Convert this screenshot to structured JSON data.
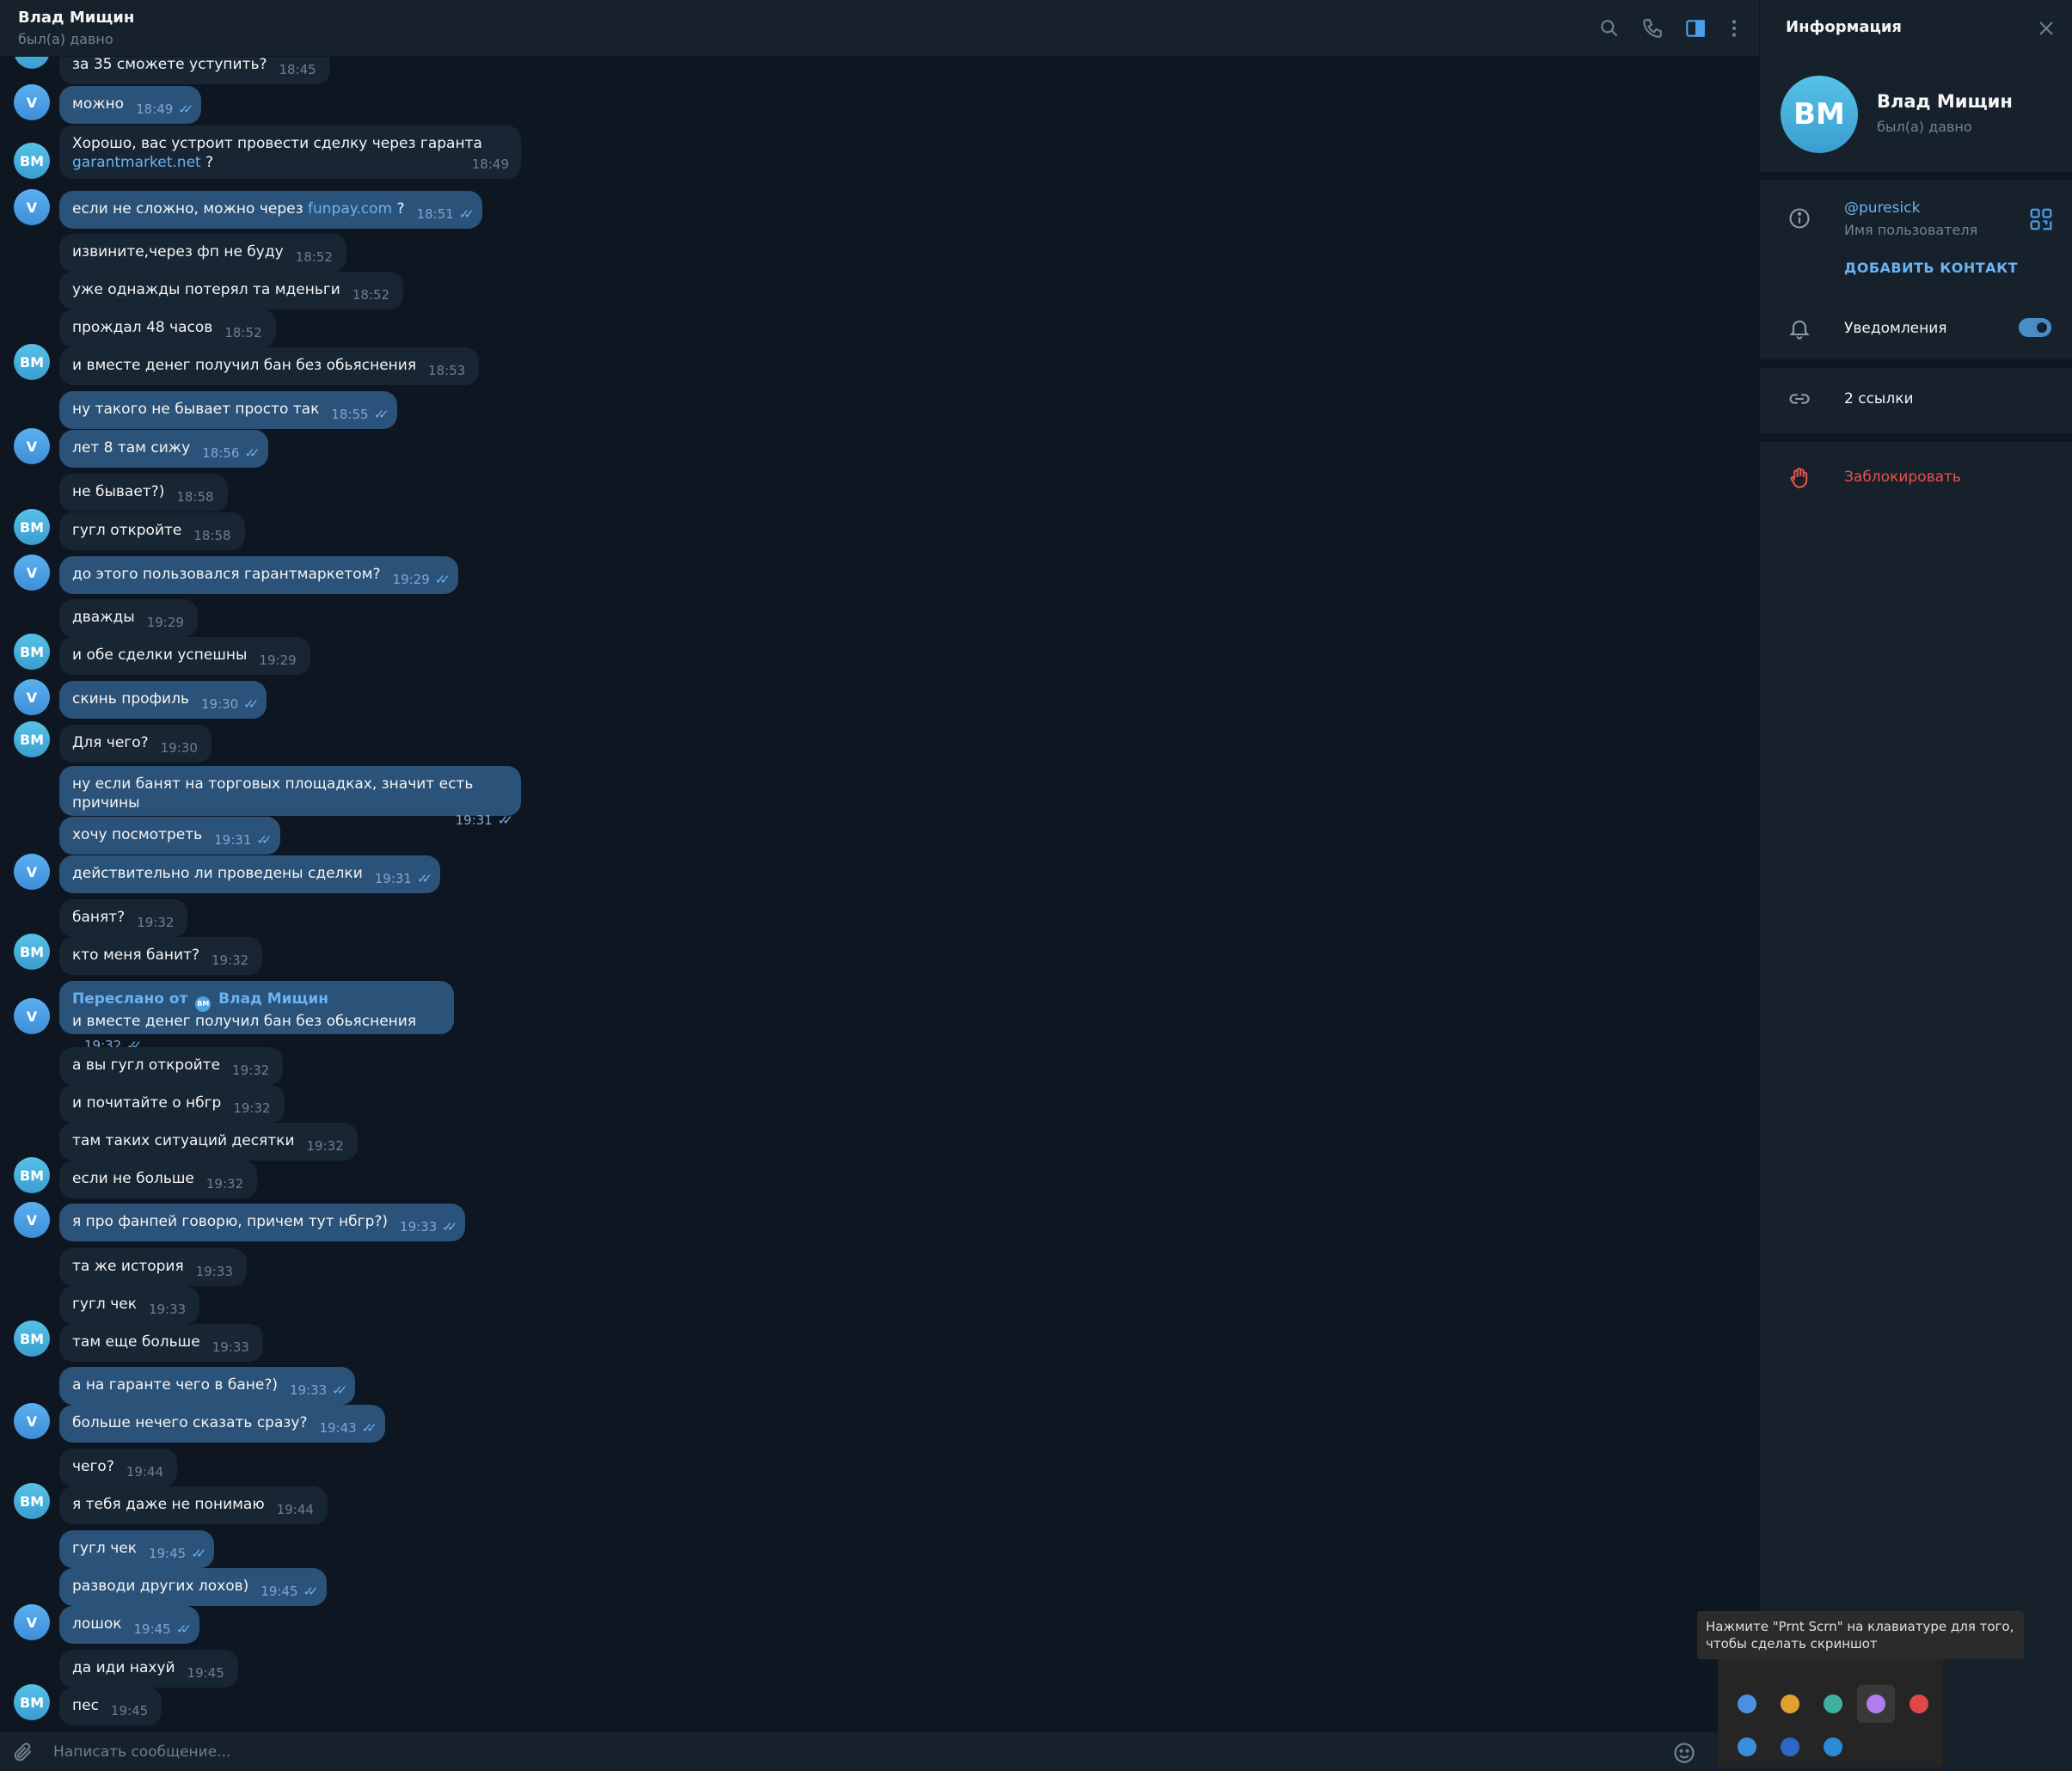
{
  "header": {
    "name": "Влад Мищин",
    "status": "был(а) давно"
  },
  "messages": [
    {
      "dir": "in",
      "text": "за 35 сможете уступить?",
      "time": "18:45",
      "read": false
    },
    {
      "dir": "out",
      "text": "можно",
      "time": "18:49",
      "read": true
    },
    {
      "dir": "in",
      "line1": "Хорошо, вас устроит провести сделку через гаранта",
      "link": "garantmarket.net",
      "after": " ?",
      "time": "18:49",
      "read": false
    },
    {
      "dir": "out",
      "pre": "если не сложно, можно через ",
      "link": "funpay.com",
      "after": " ?",
      "time": "18:51",
      "read": true
    },
    {
      "dir": "in",
      "text": "извините,через фп не буду",
      "time": "18:52",
      "read": false
    },
    {
      "dir": "in",
      "text": "уже однажды потерял та мденьги",
      "time": "18:52",
      "read": false
    },
    {
      "dir": "in",
      "text": "прождал 48 часов",
      "time": "18:52",
      "read": false
    },
    {
      "dir": "in",
      "text": "и вместе денег получил бан без обьяснения",
      "time": "18:53",
      "read": false
    },
    {
      "dir": "out",
      "text": "ну такого не бывает просто так",
      "time": "18:55",
      "read": true
    },
    {
      "dir": "out",
      "text": "лет 8 там сижу",
      "time": "18:56",
      "read": true
    },
    {
      "dir": "in",
      "text": "не бывает?)",
      "time": "18:58",
      "read": false
    },
    {
      "dir": "in",
      "text": "гугл откройте",
      "time": "18:58",
      "read": false
    },
    {
      "dir": "out",
      "text": "до этого пользовался гарантмаркетом?",
      "time": "19:29",
      "read": true
    },
    {
      "dir": "in",
      "text": "дважды",
      "time": "19:29",
      "read": false
    },
    {
      "dir": "in",
      "text": "и обе сделки успешны",
      "time": "19:29",
      "read": false
    },
    {
      "dir": "out",
      "text": "скинь профиль",
      "time": "19:30",
      "read": true
    },
    {
      "dir": "in",
      "text": "Для чего?",
      "time": "19:30",
      "read": false
    },
    {
      "dir": "out",
      "text": "ну если банят на торговых площадках, значит есть причины",
      "time": "19:31",
      "read": true
    },
    {
      "dir": "out",
      "text": "хочу посмотреть",
      "time": "19:31",
      "read": true
    },
    {
      "dir": "out",
      "text": "действительно ли проведены сделки",
      "time": "19:31",
      "read": true
    },
    {
      "dir": "in",
      "text": "банят?",
      "time": "19:32",
      "read": false
    },
    {
      "dir": "in",
      "text": "кто меня банит?",
      "time": "19:32",
      "read": false
    },
    {
      "dir": "out",
      "fwd_label": "Переслано от",
      "fwd_avatar": "ВМ",
      "fwd_name": "Влад Мищин",
      "text": "и вместе денег получил бан без обьяснения",
      "time": "19:32",
      "read": true
    },
    {
      "dir": "in",
      "text": "а вы гугл откройте",
      "time": "19:32",
      "read": false
    },
    {
      "dir": "in",
      "text": "и почитайте о нбгр",
      "time": "19:32",
      "read": false
    },
    {
      "dir": "in",
      "text": "там таких ситуаций десятки",
      "time": "19:32",
      "read": false
    },
    {
      "dir": "in",
      "text": "если не больше",
      "time": "19:32",
      "read": false
    },
    {
      "dir": "out",
      "text": "я про фанпей говорю, причем тут нбгр?)",
      "time": "19:33",
      "read": true
    },
    {
      "dir": "in",
      "text": "та же история",
      "time": "19:33",
      "read": false
    },
    {
      "dir": "in",
      "text": "гугл чек",
      "time": "19:33",
      "read": false
    },
    {
      "dir": "in",
      "text": "там еще больше",
      "time": "19:33",
      "read": false
    },
    {
      "dir": "out",
      "text": "а на гаранте чего в бане?)",
      "time": "19:33",
      "read": true
    },
    {
      "dir": "out",
      "text": "больше нечего сказать сразу?",
      "time": "19:43",
      "read": true
    },
    {
      "dir": "in",
      "text": "чего?",
      "time": "19:44",
      "read": false
    },
    {
      "dir": "in",
      "text": "я тебя даже не понимаю",
      "time": "19:44",
      "read": false
    },
    {
      "dir": "out",
      "text": "гугл чек",
      "time": "19:45",
      "read": true
    },
    {
      "dir": "out",
      "text": "разводи других лохов)",
      "time": "19:45",
      "read": true
    },
    {
      "dir": "out",
      "text": "лошок",
      "time": "19:45",
      "read": true
    },
    {
      "dir": "in",
      "text": "да иди нахуй",
      "time": "19:45",
      "read": false
    },
    {
      "dir": "in",
      "text": "пес",
      "time": "19:45",
      "read": false
    }
  ],
  "avatars": {
    "in": "ВМ",
    "out": "V"
  },
  "composer": {
    "placeholder": "Написать сообщение..."
  },
  "panel": {
    "title": "Информация",
    "avatar": "ВМ",
    "name": "Влад Мищин",
    "status": "был(а) давно",
    "username": "@puresick",
    "username_label": "Имя пользователя",
    "add_contact": "ДОБАВИТЬ КОНТАКТ",
    "notifications": "Уведомления",
    "notifications_on": true,
    "links": "2 ссылки",
    "block": "Заблокировать"
  },
  "tray": {
    "tooltip": "Нажмите \"Prnt Scrn\" на клавиатуре для того, чтобы сделать скриншот",
    "colors": [
      "#4a90e2",
      "#e0a030",
      "#3fb0a0",
      "#b07cf0",
      "#e04848",
      "#3a8fd8",
      "#2f66c8",
      "#2a8bd8"
    ]
  },
  "colors": {
    "bg": "#0e1621",
    "header": "#17212b",
    "bubble_in": "#182533",
    "bubble_out": "#2b5278",
    "accent": "#6ab3f3",
    "danger": "#e5534b"
  }
}
